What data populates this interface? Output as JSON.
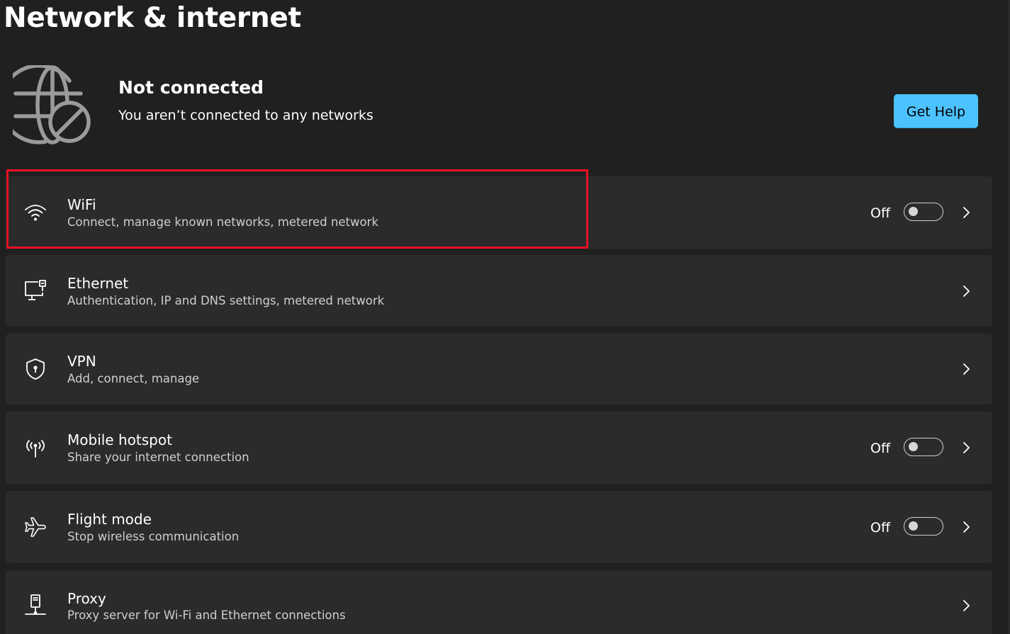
{
  "page": {
    "title": "Network & internet"
  },
  "status": {
    "icon": "globe-blocked-icon",
    "title": "Not connected",
    "subtitle": "You aren’t connected to any networks",
    "help_button_label": "Get Help"
  },
  "items": [
    {
      "id": "wifi",
      "icon": "wifi-icon",
      "title": "WiFi",
      "subtitle": "Connect, manage known networks, metered network",
      "has_toggle": true,
      "state_label": "Off",
      "toggle_on": false,
      "highlighted": true
    },
    {
      "id": "ethernet",
      "icon": "ethernet-icon",
      "title": "Ethernet",
      "subtitle": "Authentication, IP and DNS settings, metered network",
      "has_toggle": false
    },
    {
      "id": "vpn",
      "icon": "shield-icon",
      "title": "VPN",
      "subtitle": "Add, connect, manage",
      "has_toggle": false
    },
    {
      "id": "mobile-hotspot",
      "icon": "hotspot-icon",
      "title": "Mobile hotspot",
      "subtitle": "Share your internet connection",
      "has_toggle": true,
      "state_label": "Off",
      "toggle_on": false
    },
    {
      "id": "flight-mode",
      "icon": "airplane-icon",
      "title": "Flight mode",
      "subtitle": "Stop wireless communication",
      "has_toggle": true,
      "state_label": "Off",
      "toggle_on": false
    },
    {
      "id": "proxy",
      "icon": "proxy-icon",
      "title": "Proxy",
      "subtitle": "Proxy server for Wi-Fi and Ethernet connections",
      "has_toggle": false
    }
  ],
  "colors": {
    "background": "#202020",
    "card": "#2b2b2b",
    "accent": "#4cc2ff",
    "highlight": "#e81123"
  }
}
